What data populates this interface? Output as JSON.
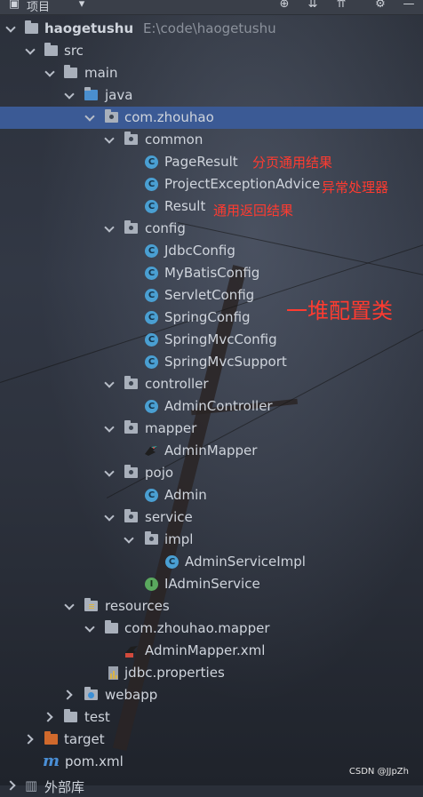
{
  "toolbar": {
    "title": "项目"
  },
  "tree": {
    "project": {
      "name": "haogetushu",
      "path": "E:\\code\\haogetushu"
    },
    "src": "src",
    "main": "main",
    "java": "java",
    "package": "com.zhouhao",
    "common": {
      "label": "common",
      "items": [
        "PageResult",
        "ProjectExceptionAdvice",
        "Result"
      ]
    },
    "config": {
      "label": "config",
      "items": [
        "JdbcConfig",
        "MyBatisConfig",
        "ServletConfig",
        "SpringConfig",
        "SpringMvcConfig",
        "SpringMvcSupport"
      ]
    },
    "controller": {
      "label": "controller",
      "items": [
        "AdminController"
      ]
    },
    "mapper": {
      "label": "mapper",
      "items": [
        "AdminMapper"
      ]
    },
    "pojo": {
      "label": "pojo",
      "items": [
        "Admin"
      ]
    },
    "service": {
      "label": "service",
      "impl": "impl",
      "impl_items": [
        "AdminServiceImpl"
      ],
      "items": [
        "IAdminService"
      ]
    },
    "resources": "resources",
    "resources_pkg": "com.zhouhao.mapper",
    "mapper_xml": "AdminMapper.xml",
    "jdbc_props": "jdbc.properties",
    "webapp": "webapp",
    "test": "test",
    "target": "target",
    "pom": "pom.xml",
    "external": "外部库"
  },
  "annotations": {
    "page_result": "分页通用结果",
    "exception": "异常处理器",
    "result": "通用返回结果",
    "config": "一堆配置类"
  },
  "colors": {
    "selection": "#3b5a95",
    "annotation": "#ff3b30",
    "class_icon": "#4a9fd2",
    "interface_icon": "#5aa85e",
    "target_folder": "#d0692c"
  },
  "watermark": "CSDN @JJpZh"
}
